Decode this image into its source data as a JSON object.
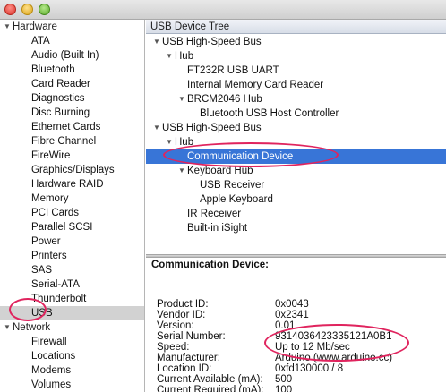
{
  "sidebar": {
    "hardware_label": "Hardware",
    "hardware_items": [
      "ATA",
      "Audio (Built In)",
      "Bluetooth",
      "Card Reader",
      "Diagnostics",
      "Disc Burning",
      "Ethernet Cards",
      "Fibre Channel",
      "FireWire",
      "Graphics/Displays",
      "Hardware RAID",
      "Memory",
      "PCI Cards",
      "Parallel SCSI",
      "Power",
      "Printers",
      "SAS",
      "Serial-ATA",
      "Thunderbolt",
      "USB"
    ],
    "selected_item": "USB",
    "network_label": "Network",
    "network_items": [
      "Firewall",
      "Locations",
      "Modems",
      "Volumes"
    ]
  },
  "tree": {
    "header": "USB Device Tree",
    "rows": [
      {
        "label": "USB High-Speed Bus",
        "level": 0,
        "expanded": true
      },
      {
        "label": "Hub",
        "level": 1,
        "expanded": true
      },
      {
        "label": "FT232R USB UART",
        "level": 2
      },
      {
        "label": "Internal Memory Card Reader",
        "level": 2
      },
      {
        "label": "BRCM2046 Hub",
        "level": 2,
        "expanded": true
      },
      {
        "label": "Bluetooth USB Host Controller",
        "level": 3
      },
      {
        "label": "USB High-Speed Bus",
        "level": 0,
        "expanded": true
      },
      {
        "label": "Hub",
        "level": 1,
        "expanded": true
      },
      {
        "label": "Communication Device",
        "level": 2,
        "selected": true
      },
      {
        "label": "Keyboard Hub",
        "level": 2,
        "expanded": true
      },
      {
        "label": "USB Receiver",
        "level": 3
      },
      {
        "label": "Apple Keyboard",
        "level": 3
      },
      {
        "label": "IR Receiver",
        "level": 2
      },
      {
        "label": "Built-in iSight",
        "level": 2
      }
    ]
  },
  "detail": {
    "title": "Communication Device:",
    "fields": [
      {
        "label": "Product ID:",
        "value": "0x0043"
      },
      {
        "label": "Vendor ID:",
        "value": "0x2341"
      },
      {
        "label": "Version:",
        "value": " 0.01"
      },
      {
        "label": "Serial Number:",
        "value": "9314036423335121A0B1"
      },
      {
        "label": "Speed:",
        "value": "Up to 12 Mb/sec"
      },
      {
        "label": "Manufacturer:",
        "value": "Arduino (www.arduino.cc)"
      },
      {
        "label": "Location ID:",
        "value": "0xfd130000 / 8"
      },
      {
        "label": "Current Available (mA):",
        "value": "500"
      },
      {
        "label": "Current Required (mA):",
        "value": "100"
      }
    ]
  },
  "colors": {
    "selection": "#3875d7",
    "annotation": "#e0245e",
    "sidebar_selected": "#d2d2d2"
  }
}
